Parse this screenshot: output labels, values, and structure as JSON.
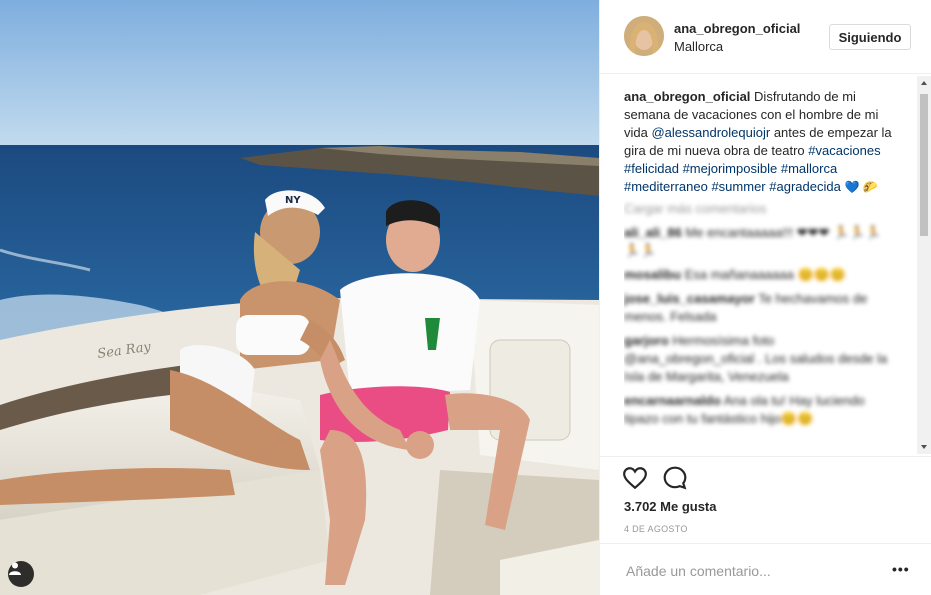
{
  "post": {
    "username": "ana_obregon_oficial",
    "location": "Mallorca",
    "follow_label": "Siguiendo",
    "boat_brand": "Sea Ray",
    "cap_logo": "NY",
    "caption": {
      "username": "ana_obregon_oficial",
      "text_1": "Disfrutando de mi semana de vacaciones con el hombre de mi vida",
      "mention": "@alessandrolequiojr",
      "text_2": "antes de empezar la gira de mi nueva obra de teatro",
      "hashtags": [
        "#vacaciones",
        "#felicidad",
        "#mejorimposible",
        "#mallorca",
        "#mediterraneo",
        "#summer",
        "#agradecida"
      ],
      "emojis": "💙 🌮"
    },
    "load_more": "Cargar más comentarios",
    "comments": [
      {
        "username": "ali_ali_86",
        "text": "Me encantaaaaa!!! ❤❤❤ 🏃🏃🏃🏃🏃"
      },
      {
        "username": "mosalibu",
        "text": "Esa mañanaaaaaa 😊😊😊"
      },
      {
        "username": "jose_luis_casamayor",
        "text": "Te hechavamos de menos. Felsada"
      },
      {
        "username": "garjoro",
        "text": "Hermosísima foto @ana_obregon_oficial . Los saludos desde la Isla de Margarita, Venezuela"
      },
      {
        "username": "encarnaarnaldo",
        "text": "Ana ola tu! Hay luciendo tipazo con tu fantástico hijo😊😊"
      }
    ],
    "likes": "3.702 Me gusta",
    "date": "4 DE AGOSTO",
    "comment_placeholder": "Añade un comentario...",
    "more_label": "•••"
  },
  "icons": {
    "like": "heart-outline-icon",
    "comment": "speech-bubble-icon",
    "tag": "user-tag-icon",
    "options": "more-options-icon"
  },
  "colors": {
    "sky": "#8ab7df",
    "sea": "#1f4f86",
    "link": "#003569",
    "muted": "#999999"
  }
}
